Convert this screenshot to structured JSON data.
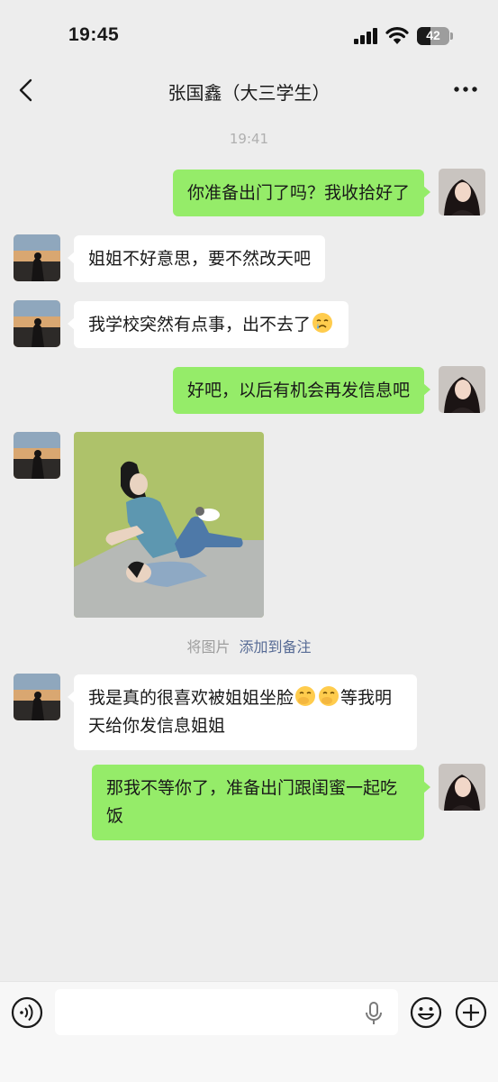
{
  "status_bar": {
    "time": "19:45",
    "battery": "42",
    "battery_level": 0.42
  },
  "nav": {
    "title": "张国鑫（大三学生）"
  },
  "chat": {
    "timestamp": "19:41",
    "messages": [
      {
        "from": "me",
        "text": "你准备出门了吗？我收拾好了"
      },
      {
        "from": "other",
        "text": "姐姐不好意思，要不然改天吧"
      },
      {
        "from": "other",
        "text": "我学校突然有点事，出不去了"
      },
      {
        "from": "me",
        "text": "好吧，以后有机会再发信息吧"
      },
      {
        "from": "other",
        "type": "image"
      },
      {
        "from": "other",
        "text_a": "我是真的很喜欢被姐姐坐脸",
        "text_b": "等我明天给你发信息姐姐"
      },
      {
        "from": "me",
        "text": "那我不等你了，准备出门跟闺蜜一起吃饭"
      }
    ],
    "system_note": {
      "text": "将图片",
      "link": "添加到备注"
    }
  },
  "input_bar": {
    "value": ""
  },
  "colors": {
    "my_bubble": "#95ec69",
    "other_bubble": "#ffffff",
    "background": "#ededed",
    "link": "#576b95"
  }
}
